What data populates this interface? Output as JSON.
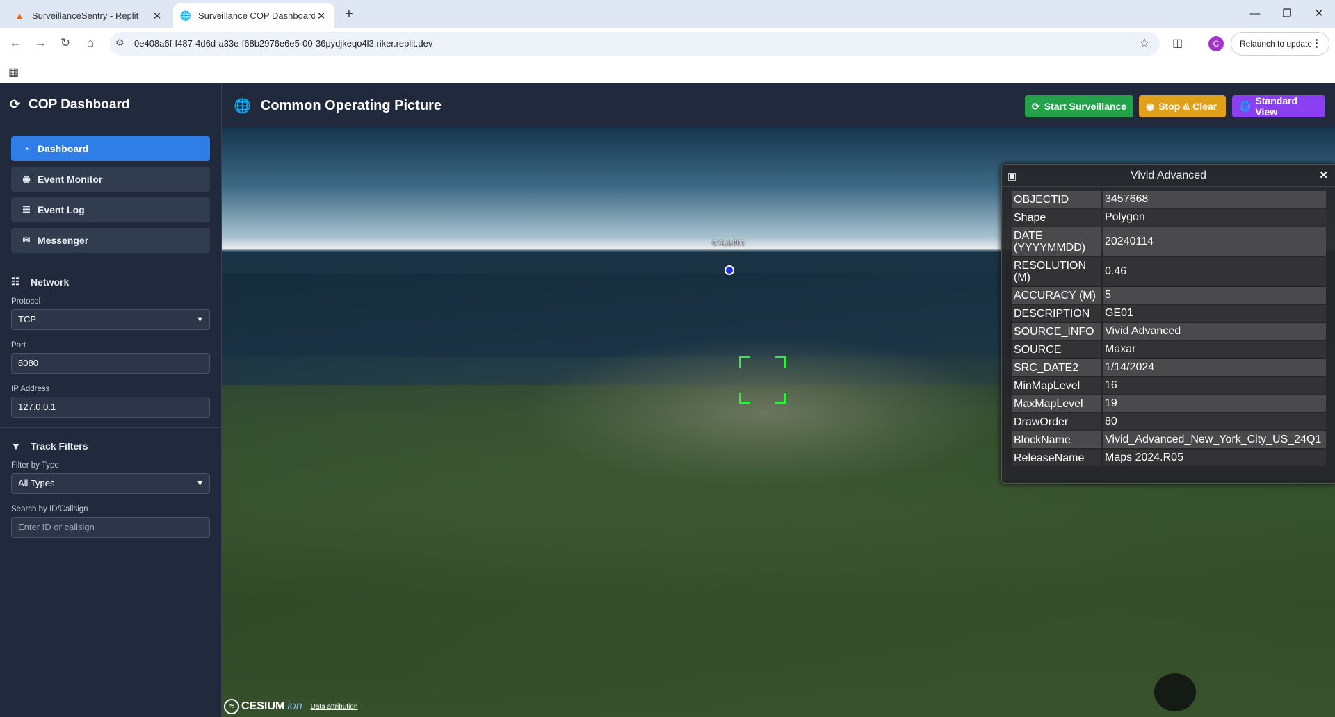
{
  "browser": {
    "tabs": [
      {
        "title": "SurveillanceSentry - Replit",
        "icon": "replit-icon",
        "active": false
      },
      {
        "title": "Surveillance COP Dashboard",
        "icon": "globe-icon",
        "active": true
      }
    ],
    "url": "0e408a6f-f487-4d6d-a33e-f68b2976e6e5-00-36pydjkeqo4l3.riker.replit.dev",
    "profile_initial": "C",
    "relaunch_label": "Relaunch to update"
  },
  "sidebar": {
    "title": "COP Dashboard",
    "nav": [
      {
        "label": "Dashboard",
        "icon": "dashboard-icon",
        "active": true
      },
      {
        "label": "Event Monitor",
        "icon": "eye-icon",
        "active": false
      },
      {
        "label": "Event Log",
        "icon": "list-icon",
        "active": false
      },
      {
        "label": "Messenger",
        "icon": "chat-icon",
        "active": false
      }
    ],
    "network": {
      "title": "Network",
      "protocol_label": "Protocol",
      "protocol_value": "TCP",
      "port_label": "Port",
      "port_value": "8080",
      "ip_label": "IP Address",
      "ip_value": "127.0.0.1"
    },
    "filters": {
      "title": "Track Filters",
      "type_label": "Filter by Type",
      "type_value": "All Types",
      "search_label": "Search by ID/Callsign",
      "search_placeholder": "Enter ID or callsign"
    }
  },
  "header": {
    "title": "Common Operating Picture",
    "start_label": "Start Surveillance",
    "stop_label": "Stop & Clear",
    "view_label": "Standard View",
    "colors": {
      "start": "#22a34a",
      "stop": "#e1a01c",
      "view": "#8a3ff0"
    }
  },
  "map": {
    "track_label": "CALL003",
    "credit_brand": "CESIUM",
    "credit_ion": "ion",
    "credit_attribution": "Data attribution"
  },
  "infobox": {
    "title": "Vivid Advanced",
    "rows": [
      {
        "key": "OBJECTID",
        "value": "3457668"
      },
      {
        "key": "Shape",
        "value": "Polygon"
      },
      {
        "key": "DATE (YYYYMMDD)",
        "value": "20240114"
      },
      {
        "key": "RESOLUTION (M)",
        "value": "0.46"
      },
      {
        "key": "ACCURACY (M)",
        "value": "5"
      },
      {
        "key": "DESCRIPTION",
        "value": "GE01"
      },
      {
        "key": "SOURCE_INFO",
        "value": "Vivid Advanced"
      },
      {
        "key": "SOURCE",
        "value": "Maxar"
      },
      {
        "key": "SRC_DATE2",
        "value": "1/14/2024"
      },
      {
        "key": "MinMapLevel",
        "value": "16"
      },
      {
        "key": "MaxMapLevel",
        "value": "19"
      },
      {
        "key": "DrawOrder",
        "value": "80"
      },
      {
        "key": "BlockName",
        "value": "Vivid_Advanced_New_York_City_US_24Q1"
      },
      {
        "key": "ReleaseName",
        "value": "Maps 2024.R05"
      }
    ]
  }
}
